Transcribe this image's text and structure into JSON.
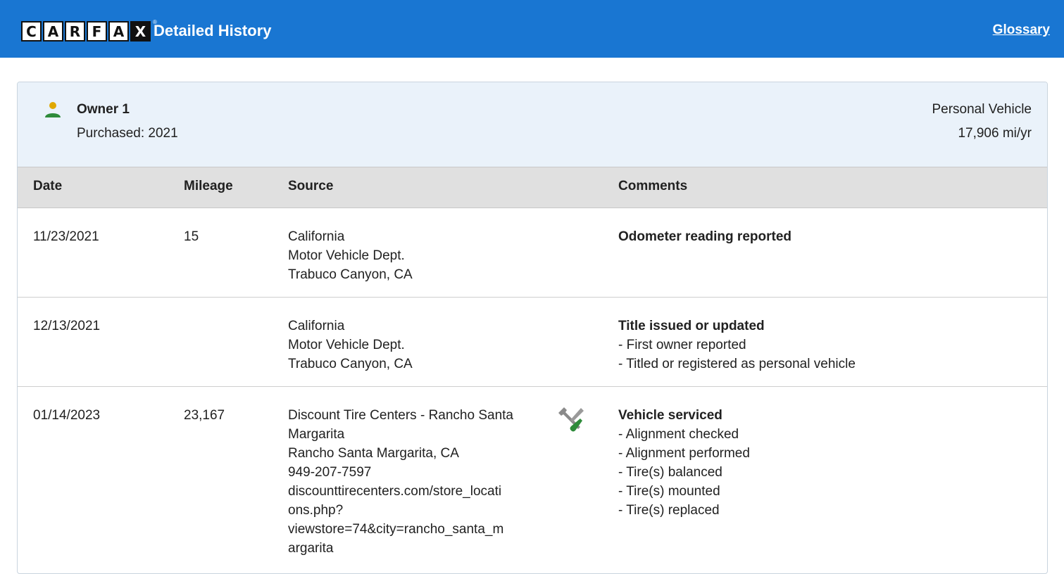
{
  "header": {
    "logo_letters": [
      "C",
      "A",
      "R",
      "F",
      "A",
      "X"
    ],
    "title": "Detailed History",
    "glossary_link": "Glossary",
    "colors": {
      "bar": "#1976d2"
    }
  },
  "owner": {
    "icon": "person-icon",
    "title": "Owner 1",
    "purchased": "Purchased: 2021",
    "vehicle_type": "Personal Vehicle",
    "miles_per_year": "17,906 mi/yr"
  },
  "table": {
    "columns": {
      "date": "Date",
      "mileage": "Mileage",
      "source": "Source",
      "comments": "Comments"
    },
    "rows": [
      {
        "date": "11/23/2021",
        "mileage": "15",
        "source": [
          "California",
          "Motor Vehicle Dept.",
          "Trabuco Canyon, CA"
        ],
        "comment_title": "Odometer reading reported",
        "comment_items": []
      },
      {
        "date": "12/13/2021",
        "mileage": "",
        "source": [
          "California",
          "Motor Vehicle Dept.",
          "Trabuco Canyon, CA"
        ],
        "comment_title": "Title issued or updated",
        "comment_items": [
          "First owner reported",
          "Titled or registered as personal vehicle"
        ]
      },
      {
        "date": "01/14/2023",
        "mileage": "23,167",
        "service_icon": "wrench-screwdriver-icon",
        "source": [
          "Discount Tire Centers - Rancho Santa",
          "Margarita",
          "Rancho Santa Margarita, CA",
          "949-207-7597",
          "discounttirecenters.com/store_locati",
          "ons.php?",
          "viewstore=74&city=rancho_santa_m",
          "argarita"
        ],
        "comment_title": "Vehicle serviced",
        "comment_items": [
          "Alignment checked",
          "Alignment performed",
          "Tire(s) balanced",
          "Tire(s) mounted",
          "Tire(s) replaced"
        ]
      }
    ]
  }
}
